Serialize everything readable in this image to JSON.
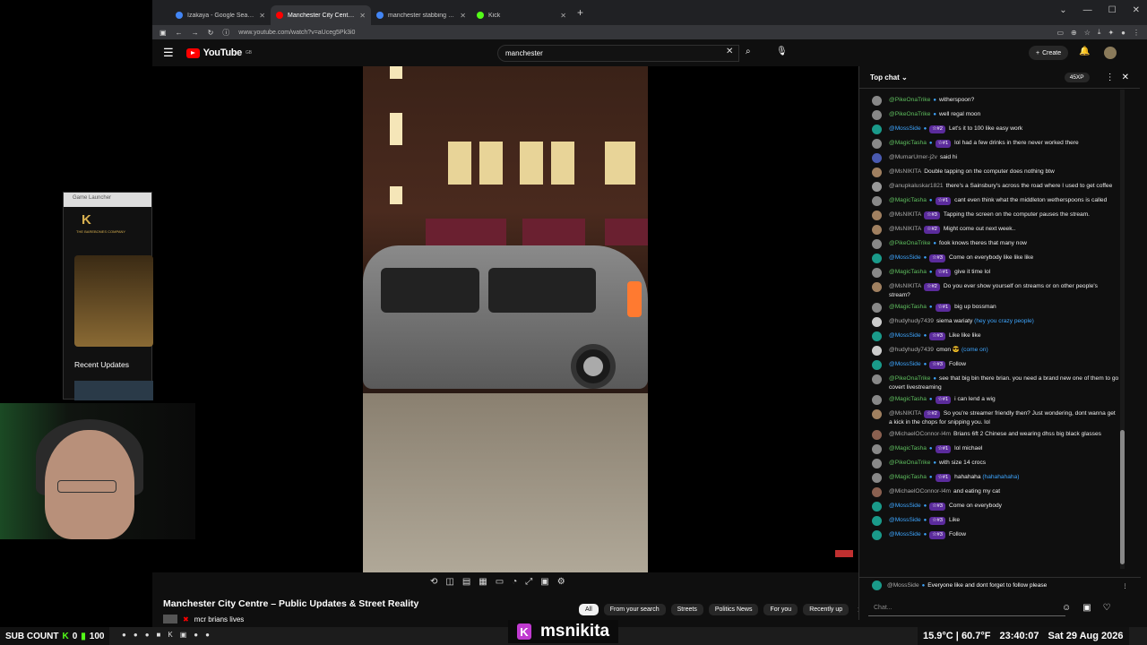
{
  "browser": {
    "tabs": [
      {
        "label": "Izakaya - Google Search",
        "fav": "#4285f4",
        "active": false
      },
      {
        "label": "Manchester City Centre - P",
        "fav": "#ff0000",
        "active": true
      },
      {
        "label": "manchester stabbing - Google",
        "fav": "#4285f4",
        "active": false
      },
      {
        "label": "Kick",
        "fav": "#53fc18",
        "active": false
      }
    ],
    "url": "www.youtube.com/watch?v=aUceg5Pk3i0"
  },
  "youtube": {
    "logo_text": "YouTube",
    "logo_sup": "GB",
    "search_value": "manchester",
    "create_label": "Create"
  },
  "video": {
    "title": "Manchester City Centre – Public Updates & Street Reality",
    "channel": "mcr brians lives",
    "chips": [
      "All",
      "From your search",
      "Streets",
      "Politics News",
      "For you",
      "Recently up"
    ]
  },
  "chat": {
    "header": "Top chat",
    "xp": "45XP",
    "messages": [
      {
        "name": "@PikeOnaTrike",
        "color": "green",
        "verified": true,
        "badge": "",
        "text": "witherspoon?",
        "av": "#888"
      },
      {
        "name": "@PikeOnaTrike",
        "color": "green",
        "verified": true,
        "badge": "",
        "text": "well regal moon",
        "av": "#888"
      },
      {
        "name": "@MossSide",
        "color": "blue",
        "verified": true,
        "badge": "#2",
        "text": "Let's it to 100 like easy work",
        "av": "#1a9a8a"
      },
      {
        "name": "@MagicTasha",
        "color": "green",
        "verified": true,
        "badge": "#1",
        "text": "lol had a few drinks in there never worked there",
        "av": "#888"
      },
      {
        "name": "@MumarUmer-j2v",
        "color": "grey",
        "verified": false,
        "badge": "",
        "text": "said hi",
        "av": "#4a5ab0"
      },
      {
        "name": "@MsNIKITA",
        "color": "grey",
        "verified": false,
        "badge": "",
        "text": "Double tapping on the computer does nothing btw",
        "av": "#a08060"
      },
      {
        "name": "@anupkaluskar1821",
        "color": "grey",
        "verified": false,
        "badge": "",
        "text": "there's a Sainsbury's across the road where I used to get coffee",
        "av": "#999"
      },
      {
        "name": "@MagicTasha",
        "color": "green",
        "verified": true,
        "badge": "#1",
        "text": "cant even think what the middleton wetherspoons is called",
        "av": "#888"
      },
      {
        "name": "@MsNIKITA",
        "color": "grey",
        "verified": false,
        "badge": "#3",
        "text": "Tapping the screen on the computer pauses the stream.",
        "av": "#a08060"
      },
      {
        "name": "@MsNIKITA",
        "color": "grey",
        "verified": false,
        "badge": "#2",
        "text": "Might come out next week..",
        "av": "#a08060"
      },
      {
        "name": "@PikeOnaTrike",
        "color": "green",
        "verified": true,
        "badge": "",
        "text": "fook knows theres that many now",
        "av": "#888"
      },
      {
        "name": "@MossSide",
        "color": "blue",
        "verified": true,
        "badge": "#3",
        "text": "Come on everybody like like like",
        "av": "#1a9a8a"
      },
      {
        "name": "@MagicTasha",
        "color": "green",
        "verified": true,
        "badge": "#1",
        "text": "give it time lol",
        "av": "#888"
      },
      {
        "name": "@MsNIKITA",
        "color": "grey",
        "verified": false,
        "badge": "#2",
        "text": "Do you ever show yourself on streams or on other people's stream?",
        "av": "#a08060"
      },
      {
        "name": "@MagicTasha",
        "color": "green",
        "verified": true,
        "badge": "#1",
        "text": "big up bossman",
        "av": "#888"
      },
      {
        "name": "@hudyhudy7439",
        "color": "grey",
        "verified": false,
        "badge": "",
        "text": "siema wariaty",
        "extra": "(hey you crazy people)",
        "av": "#ccc"
      },
      {
        "name": "@MossSide",
        "color": "blue",
        "verified": true,
        "badge": "#3",
        "text": "Like like like",
        "av": "#1a9a8a"
      },
      {
        "name": "@hudyhudy7439",
        "color": "grey",
        "verified": false,
        "badge": "",
        "text": "cmon 😎",
        "extra": "(come on)",
        "av": "#ccc"
      },
      {
        "name": "@MossSide",
        "color": "blue",
        "verified": true,
        "badge": "#3",
        "text": "Follow",
        "av": "#1a9a8a"
      },
      {
        "name": "@PikeOnaTrike",
        "color": "green",
        "verified": true,
        "badge": "",
        "text": "see that big bin there brian. you need a brand new one of them to go covert livestreaming",
        "av": "#888"
      },
      {
        "name": "@MagicTasha",
        "color": "green",
        "verified": true,
        "badge": "#1",
        "text": "i can lend a wig",
        "av": "#888"
      },
      {
        "name": "@MsNIKITA",
        "color": "grey",
        "verified": false,
        "badge": "#2",
        "text": "So you're streamer friendly then? Just wondering, dont wanna get a kick in the chops for snipping you. lol",
        "av": "#a08060"
      },
      {
        "name": "@MichaelOConnor-l4m",
        "color": "grey",
        "verified": false,
        "badge": "",
        "text": "Brians 6ft 2 Chinese and wearing dhss big black glasses",
        "av": "#8a6050"
      },
      {
        "name": "@MagicTasha",
        "color": "green",
        "verified": true,
        "badge": "#1",
        "text": "lol michael",
        "av": "#888"
      },
      {
        "name": "@PikeOnaTrike",
        "color": "green",
        "verified": true,
        "badge": "",
        "text": "with size 14 crocs",
        "av": "#888"
      },
      {
        "name": "@MagicTasha",
        "color": "green",
        "verified": true,
        "badge": "#1",
        "text": "hahahaha",
        "extra": "(hahahahaha)",
        "av": "#888"
      },
      {
        "name": "@MichaelOConnor-l4m",
        "color": "grey",
        "verified": false,
        "badge": "",
        "text": "and eating my cat",
        "av": "#8a6050"
      },
      {
        "name": "@MossSide",
        "color": "blue",
        "verified": true,
        "badge": "#3",
        "text": "Come on everybody",
        "av": "#1a9a8a"
      },
      {
        "name": "@MossSide",
        "color": "blue",
        "verified": true,
        "badge": "#3",
        "text": "Like",
        "av": "#1a9a8a"
      },
      {
        "name": "@MossSide",
        "color": "blue",
        "verified": true,
        "badge": "#3",
        "text": "Follow",
        "av": "#1a9a8a"
      }
    ],
    "pinned": {
      "name": "@MossSide",
      "text": "Everyone like and dont forget to follow please"
    },
    "input_placeholder": "Chat..."
  },
  "launcher": {
    "title": "Game Launcher",
    "logo": "K",
    "company": "THE BAREBONES COMPANY",
    "recent_updates": "Recent Updates"
  },
  "overlay": {
    "sub_count_label": "SUB COUNT",
    "sub_count_value": "0",
    "sub_goal": "100",
    "streamer": "msnikita",
    "temperature": "15.9°C | 60.7°F",
    "time": "23:40:07",
    "date": "Sat 29 Aug 2026"
  }
}
